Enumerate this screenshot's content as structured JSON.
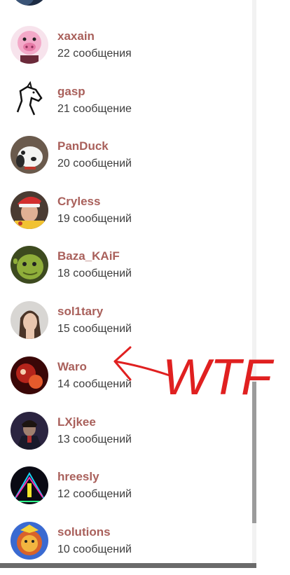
{
  "users": [
    {
      "name": "xaxain",
      "messages": "22 сообщения",
      "avatar_icon": "pink-pig-cartoon-avatar-icon"
    },
    {
      "name": "gasp",
      "messages": "21 сообщение",
      "avatar_icon": "horse-head-sketch-avatar-icon"
    },
    {
      "name": "PanDuck",
      "messages": "20 сообщений",
      "avatar_icon": "white-dog-avatar-icon"
    },
    {
      "name": "Cryless",
      "messages": "19 сообщений",
      "avatar_icon": "man-santa-hat-avatar-icon"
    },
    {
      "name": "Baza_KAiF",
      "messages": "18 сообщений",
      "avatar_icon": "green-ogre-avatar-icon"
    },
    {
      "name": "sol1tary",
      "messages": "15 сообщений",
      "avatar_icon": "woman-portrait-avatar-icon"
    },
    {
      "name": "Waro",
      "messages": "14 сообщений",
      "avatar_icon": "red-dark-artwork-avatar-icon"
    },
    {
      "name": "LXjkee",
      "messages": "13 сообщений",
      "avatar_icon": "dark-game-character-avatar-icon"
    },
    {
      "name": "hreesly",
      "messages": "12 сообщений",
      "avatar_icon": "neon-lights-avatar-icon"
    },
    {
      "name": "solutions",
      "messages": "10 сообщений",
      "avatar_icon": "lion-mascot-avatar-icon"
    }
  ],
  "annotation": {
    "text": "WTF",
    "color": "#e02020",
    "arrow_icon": "red-arrow-icon"
  },
  "colors": {
    "username": "#a9605b",
    "count_text": "#3d3d3d",
    "scroll_thumb": "#9b9b9b"
  }
}
